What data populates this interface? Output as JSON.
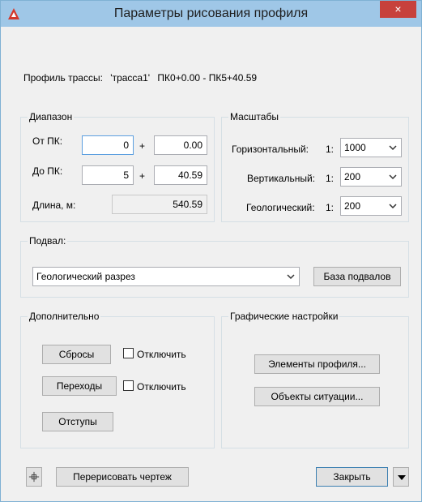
{
  "window": {
    "title": "Параметры рисования профиля",
    "close_glyph": "×",
    "colors": {
      "titlebar": "#9fc7e7",
      "close": "#c7413c",
      "app_icon": "#d3382b"
    }
  },
  "profile": {
    "label": "Профиль трассы:",
    "name": "'трасса1'",
    "range": "ПК0+0.00 - ПК5+40.59"
  },
  "range_group": {
    "title": "Диапазон",
    "from_label": "От ПК:",
    "from_pk": "0",
    "from_plus": "+",
    "from_offset": "0.00",
    "to_label": "До ПК:",
    "to_pk": "5",
    "to_plus": "+",
    "to_offset": "40.59",
    "length_label": "Длина, м:",
    "length_value": "540.59"
  },
  "scales_group": {
    "title": "Масштабы",
    "horizontal_label": "Горизонтальный:",
    "horizontal_prefix": "1:",
    "horizontal_value": "1000",
    "vertical_label": "Вертикальный:",
    "vertical_prefix": "1:",
    "vertical_value": "200",
    "geological_label": "Геологический:",
    "geological_prefix": "1:",
    "geological_value": "200"
  },
  "basement_group": {
    "title": "Подвал:",
    "selected": "Геологический разрез",
    "base_button": "База подвалов"
  },
  "extra_group": {
    "title": "Дополнительно",
    "drops_button": "Сбросы",
    "drops_disable": "Отключить",
    "transitions_button": "Переходы",
    "transitions_disable": "Отключить",
    "offsets_button": "Отступы"
  },
  "graphics_group": {
    "title": "Графические настройки",
    "profile_elements_button": "Элементы профиля...",
    "situation_objects_button": "Объекты ситуации..."
  },
  "footer": {
    "redraw_button": "Перерисовать чертеж",
    "close_button": "Закрыть"
  }
}
